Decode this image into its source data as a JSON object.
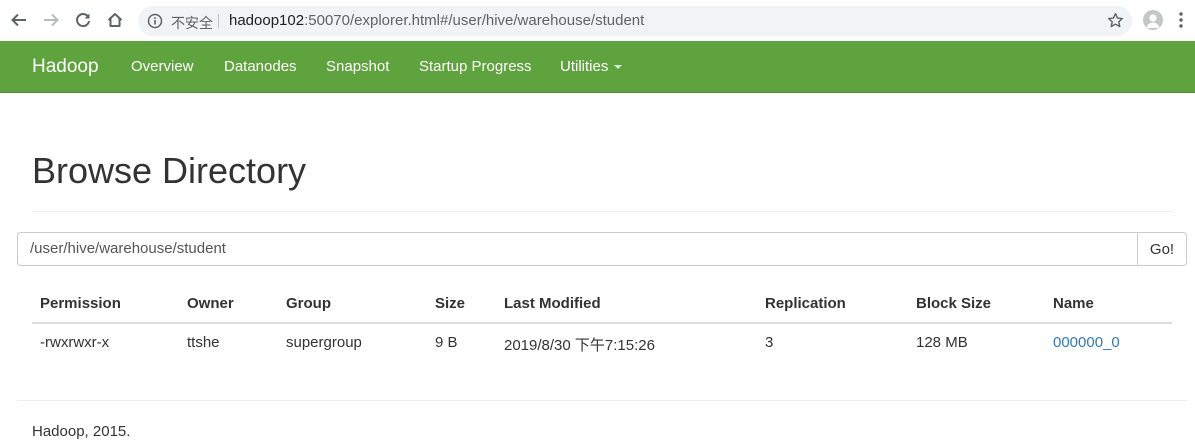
{
  "browser": {
    "insecure_label": "不安全",
    "url_host": "hadoop102",
    "url_rest": ":50070/explorer.html#/user/hive/warehouse/student"
  },
  "navbar": {
    "brand": "Hadoop",
    "items": [
      {
        "label": "Overview"
      },
      {
        "label": "Datanodes"
      },
      {
        "label": "Snapshot"
      },
      {
        "label": "Startup Progress"
      },
      {
        "label": "Utilities"
      }
    ]
  },
  "page": {
    "title": "Browse Directory",
    "path_value": "/user/hive/warehouse/student",
    "go_label": "Go!"
  },
  "table": {
    "headers": [
      "Permission",
      "Owner",
      "Group",
      "Size",
      "Last Modified",
      "Replication",
      "Block Size",
      "Name"
    ],
    "rows": [
      [
        "-rwxrwxr-x",
        "ttshe",
        "supergroup",
        "9 B",
        "2019/8/30 下午7:15:26",
        "3",
        "128 MB",
        "000000_0"
      ]
    ]
  },
  "footer": {
    "text": "Hadoop, 2015."
  },
  "colors": {
    "navbar": "#5fa33e",
    "link": "#337ab7"
  }
}
